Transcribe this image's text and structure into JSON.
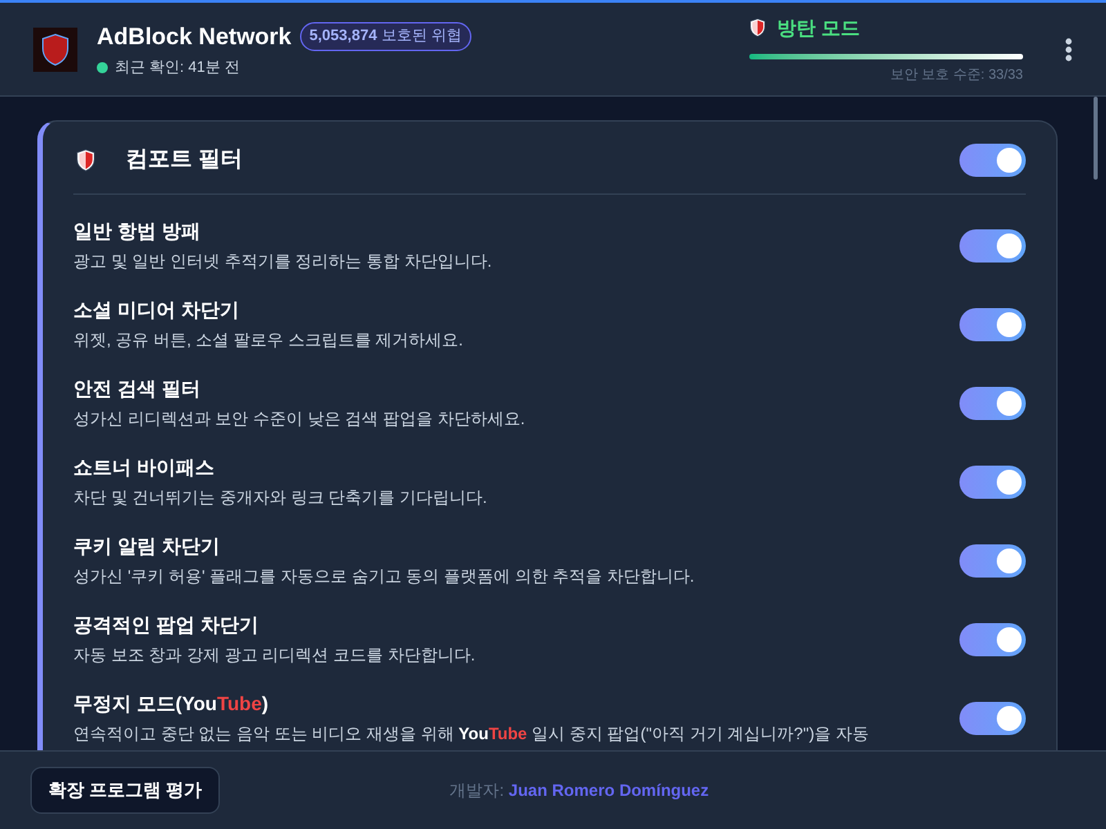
{
  "header": {
    "title": "AdBlock Network",
    "count": "5,053,874",
    "count_label": "보호된 위협",
    "status": "최근 확인: 41분 전",
    "online": true,
    "mode": "방탄 모드",
    "level": 1,
    "level_label": "보안 보호 수준: 33/33"
  },
  "card": {
    "title": "컴포트 필터",
    "on": true,
    "filters": [
      {
        "title": [
          {
            "text": "일반 항법 방패",
            "kind": "plain"
          }
        ],
        "description": [
          {
            "text": "광고 및 일반 인터넷 추적기를 정리하는 통합 차단입니다.",
            "kind": "plain"
          }
        ],
        "on": true
      },
      {
        "title": [
          {
            "text": "소셜 미디어 차단기",
            "kind": "plain"
          }
        ],
        "description": [
          {
            "text": "위젯, 공유 버튼, 소셜 팔로우 스크립트를 제거하세요.",
            "kind": "plain"
          }
        ],
        "on": true
      },
      {
        "title": [
          {
            "text": "안전 검색 필터",
            "kind": "plain"
          }
        ],
        "description": [
          {
            "text": "성가신 리디렉션과 보안 수준이 낮은 검색 팝업을 차단하세요.",
            "kind": "plain"
          }
        ],
        "on": true
      },
      {
        "title": [
          {
            "text": "쇼트너 바이패스",
            "kind": "plain"
          }
        ],
        "description": [
          {
            "text": "차단 및 건너뛰기는 중개자와 링크 단축기를 기다립니다.",
            "kind": "plain"
          }
        ],
        "on": true
      },
      {
        "title": [
          {
            "text": "쿠키 알림 차단기",
            "kind": "plain"
          }
        ],
        "description": [
          {
            "text": "성가신 '쿠키 허용' 플래그를 자동으로 숨기고 동의 플랫폼에 의한 추적을 차단합니다.",
            "kind": "plain"
          }
        ],
        "on": true
      },
      {
        "title": [
          {
            "text": "공격적인 팝업 차단기",
            "kind": "plain"
          }
        ],
        "description": [
          {
            "text": "자동 보조 창과 강제 광고 리디렉션 코드를 차단합니다.",
            "kind": "plain"
          }
        ],
        "on": true
      },
      {
        "title": [
          {
            "text": "무정지 모드(",
            "kind": "plain"
          },
          {
            "text": "You",
            "kind": "brand"
          },
          {
            "text": "Tube",
            "kind": "brand_red"
          },
          {
            "text": ")",
            "kind": "plain"
          }
        ],
        "description": [
          {
            "text": "연속적이고 중단 없는 음악 또는 비디오 재생을 위해 ",
            "kind": "plain"
          },
          {
            "text": "You",
            "kind": "brand"
          },
          {
            "text": "Tube",
            "kind": "brand_red"
          },
          {
            "text": " 일시 중지 팝업(\"아직 거기 계십니까?\")을 자동",
            "kind": "plain"
          }
        ],
        "on": true
      }
    ]
  },
  "footer": {
    "button": "확장 프로그램 평가",
    "credit_label": "개발자:",
    "credit_name": "Juan Romero Domínguez"
  }
}
